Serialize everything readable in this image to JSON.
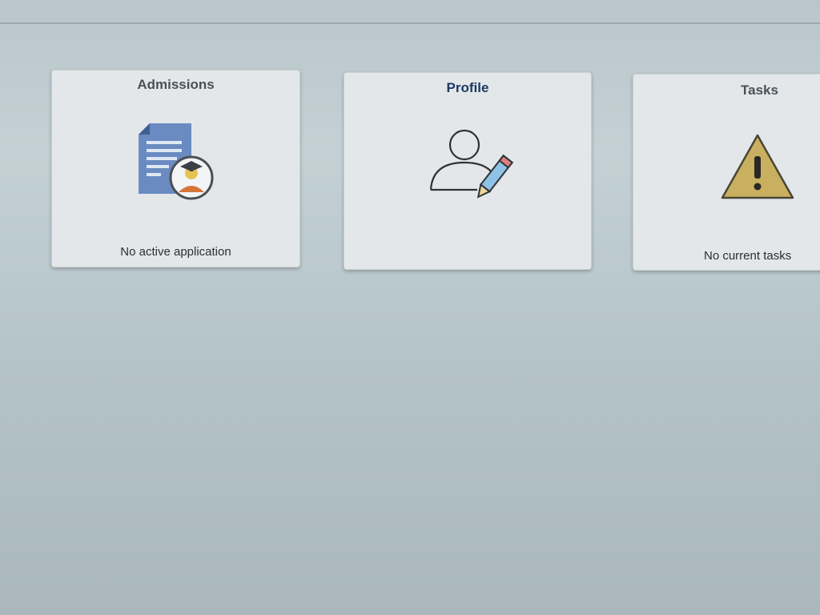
{
  "tiles": [
    {
      "title": "Admissions",
      "status": "No active application",
      "icon": "document-graduate-icon"
    },
    {
      "title": "Profile",
      "status": "",
      "icon": "user-edit-icon"
    },
    {
      "title": "Tasks",
      "status": "No current tasks",
      "icon": "warning-icon"
    }
  ],
  "colors": {
    "document_blue": "#6a8bc2",
    "warning_fill": "#c9b060",
    "title_accent": "#1c3a63"
  }
}
